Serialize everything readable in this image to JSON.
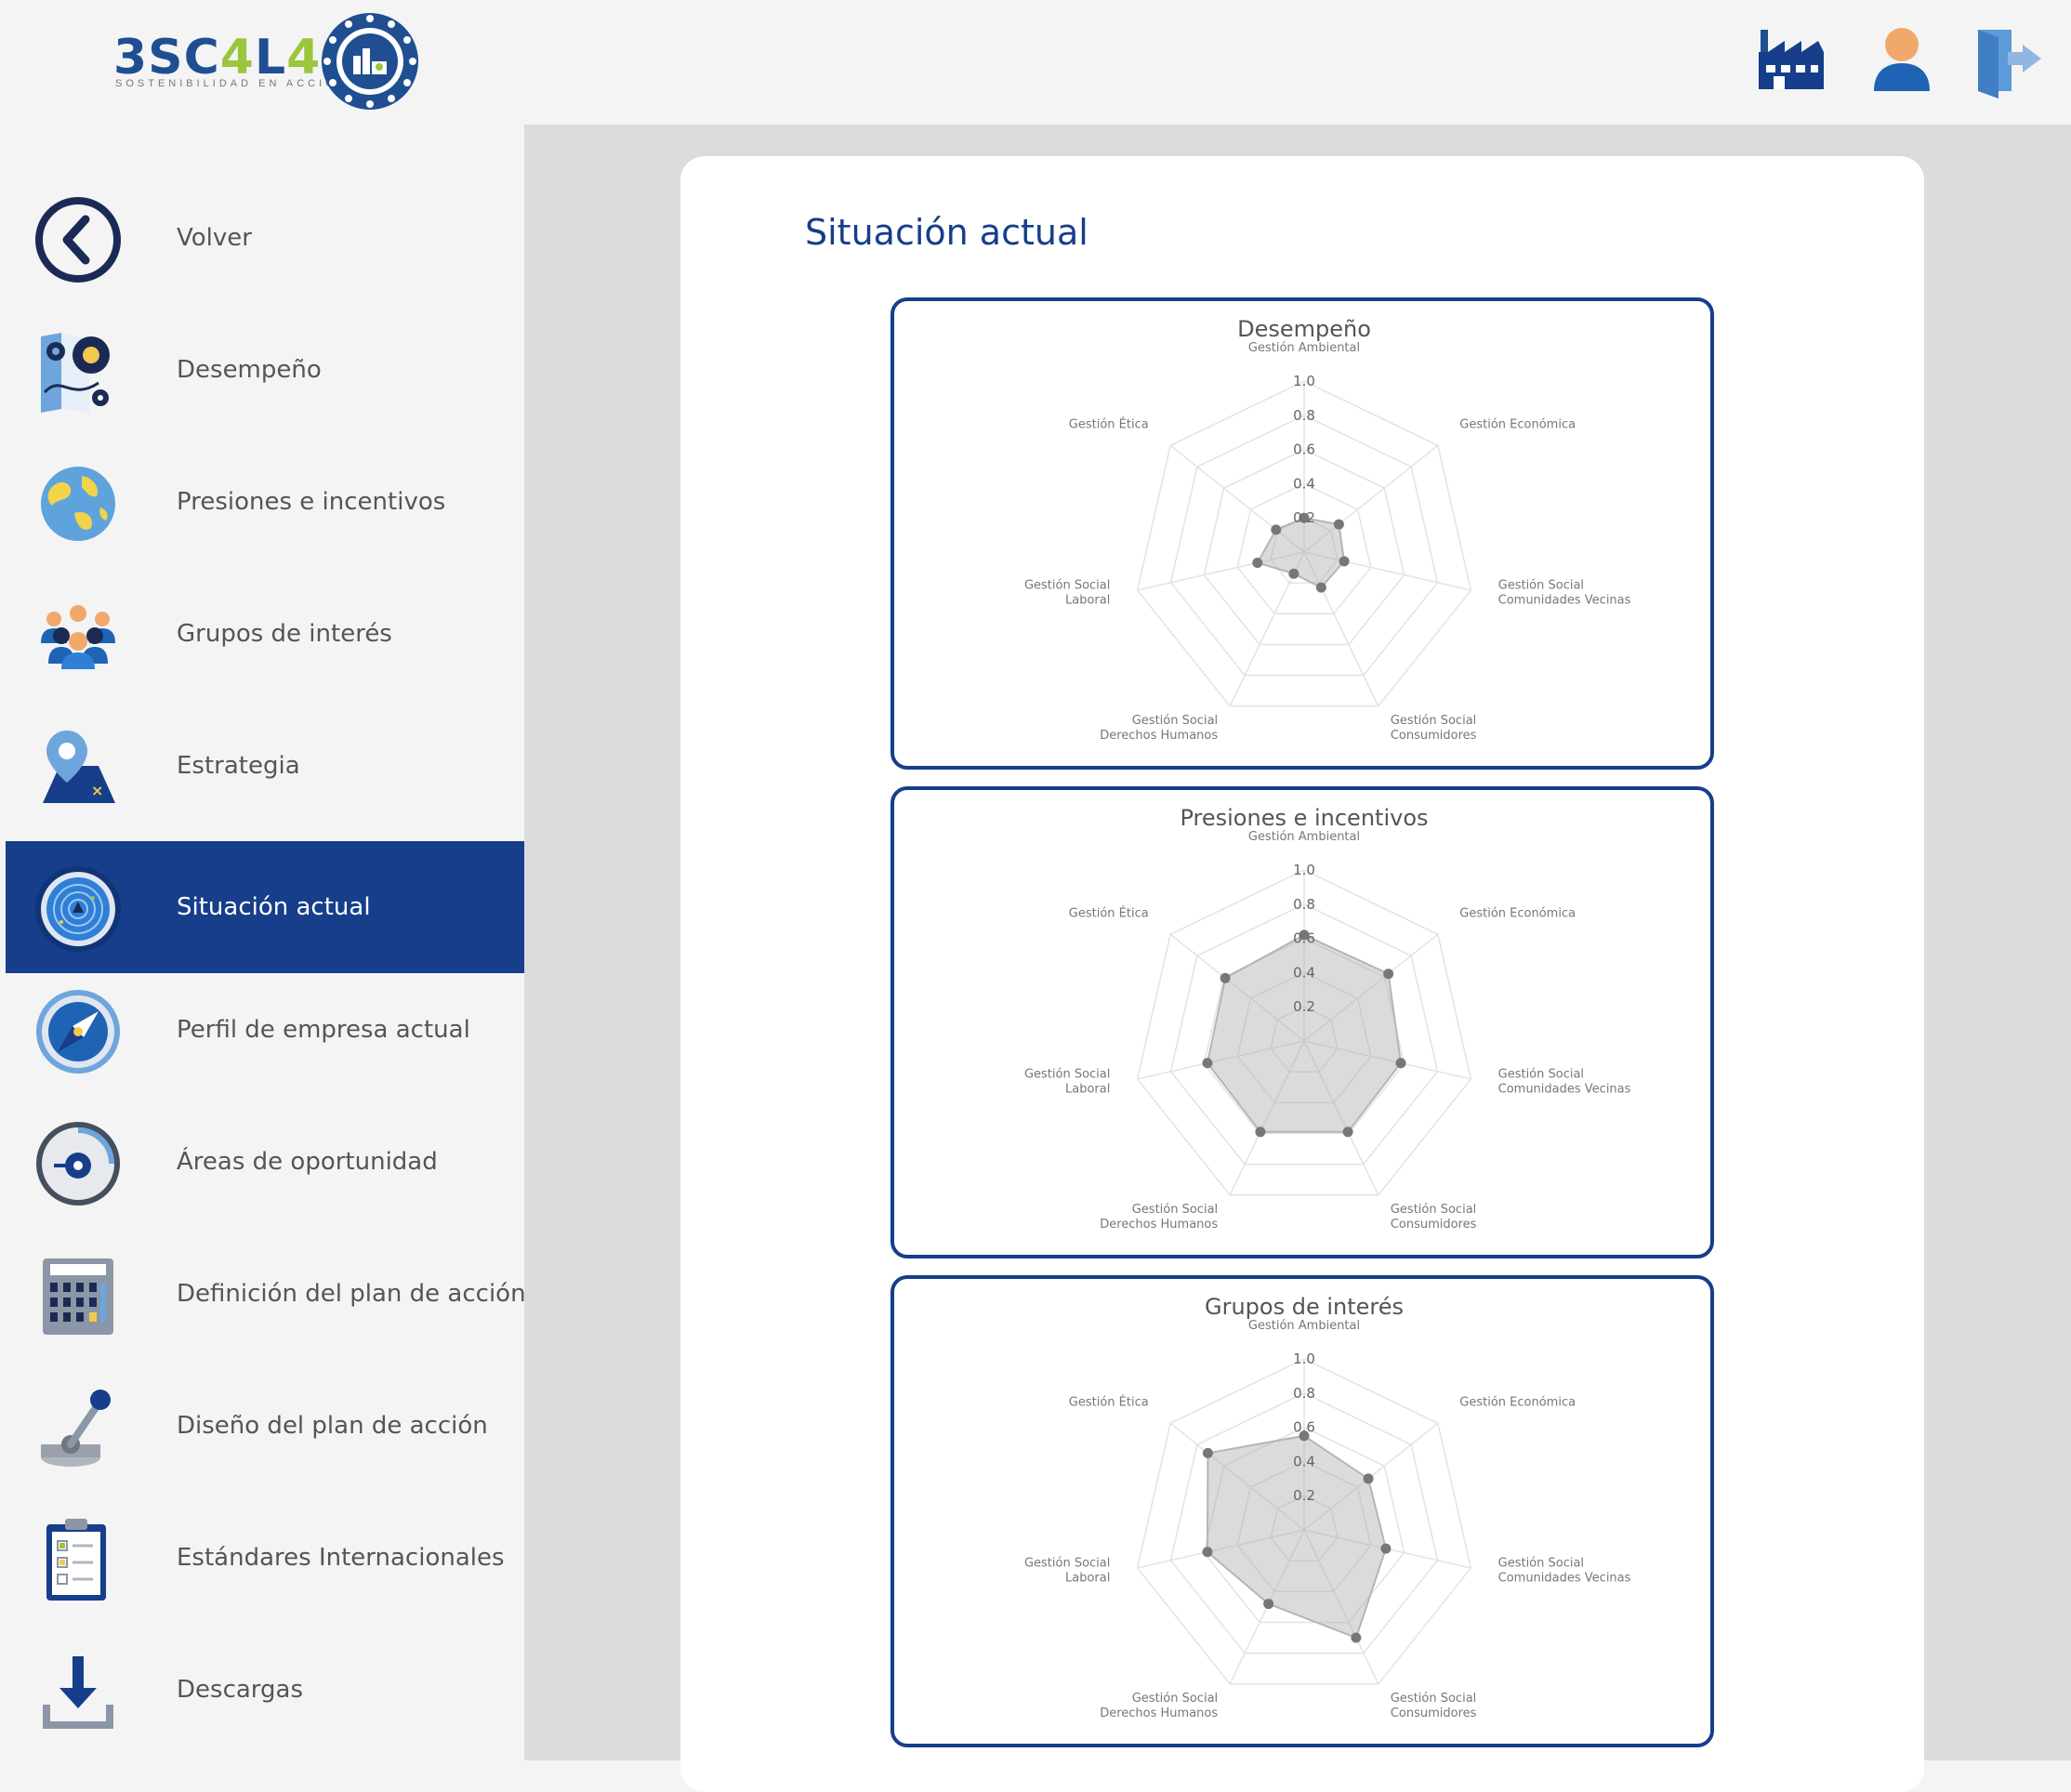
{
  "brand": {
    "logo_text": "3SC4L4",
    "logo_tagline": "SOSTENIBILIDAD EN ACCIÓN"
  },
  "header": {
    "icons": [
      "factory-icon",
      "user-icon",
      "logout-icon"
    ]
  },
  "sidebar": {
    "active_index": 5,
    "items": [
      {
        "label": "Volver",
        "icon": "back-arrow-icon"
      },
      {
        "label": "Desempeño",
        "icon": "gears-map-icon"
      },
      {
        "label": "Presiones e incentivos",
        "icon": "globe-icon"
      },
      {
        "label": "Grupos de interés",
        "icon": "people-group-icon"
      },
      {
        "label": "Estrategia",
        "icon": "map-pin-icon"
      },
      {
        "label": "Situación actual",
        "icon": "radar-icon"
      },
      {
        "label": "Perfil de empresa actual",
        "icon": "compass-icon"
      },
      {
        "label": "Áreas de oportunidad",
        "icon": "gauge-icon"
      },
      {
        "label": "Definición del plan de acción",
        "icon": "calculator-icon"
      },
      {
        "label": "Diseño del plan de acción",
        "icon": "joystick-icon"
      },
      {
        "label": "Estándares Internacionales",
        "icon": "clipboard-icon"
      },
      {
        "label": "Descargas",
        "icon": "download-icon"
      }
    ]
  },
  "main": {
    "title": "Situación actual"
  },
  "colors": {
    "primary": "#163e8a",
    "accent_green": "#9bc53d",
    "sidebar_bg": "#f4f4f4",
    "content_bg": "#dcdcdc",
    "radar_fill": "#dedede",
    "radar_point": "#777777"
  },
  "chart_data": [
    {
      "type": "radar",
      "title": "Desempeño",
      "axes": [
        "Gestión Ambiental",
        "Gestión Económica",
        "Gestión Social|Comunidades Vecinas",
        "Gestión Social|Consumidores",
        "Gestión Social|Derechos Humanos",
        "Gestión Social|Laboral",
        "Gestión Ética"
      ],
      "ticks": [
        "0.2",
        "0.4",
        "0.6",
        "0.8",
        "1.0"
      ],
      "range": [
        0,
        1
      ],
      "values": [
        0.2,
        0.26,
        0.24,
        0.23,
        0.14,
        0.28,
        0.21
      ]
    },
    {
      "type": "radar",
      "title": "Presiones e incentivos",
      "axes": [
        "Gestión Ambiental",
        "Gestión Económica",
        "Gestión Social|Comunidades Vecinas",
        "Gestión Social|Consumidores",
        "Gestión Social|Derechos Humanos",
        "Gestión Social|Laboral",
        "Gestión Ética"
      ],
      "ticks": [
        "0.2",
        "0.4",
        "0.6",
        "0.8",
        "1.0"
      ],
      "range": [
        0,
        1
      ],
      "values": [
        0.62,
        0.63,
        0.58,
        0.59,
        0.59,
        0.58,
        0.59
      ]
    },
    {
      "type": "radar",
      "title": "Grupos de interés",
      "axes": [
        "Gestión Ambiental",
        "Gestión Económica",
        "Gestión Social|Comunidades Vecinas",
        "Gestión Social|Consumidores",
        "Gestión Social|Derechos Humanos",
        "Gestión Social|Laboral",
        "Gestión Ética"
      ],
      "ticks": [
        "0.2",
        "0.4",
        "0.6",
        "0.8",
        "1.0"
      ],
      "range": [
        0,
        1
      ],
      "values": [
        0.55,
        0.48,
        0.49,
        0.7,
        0.48,
        0.58,
        0.72
      ]
    }
  ]
}
